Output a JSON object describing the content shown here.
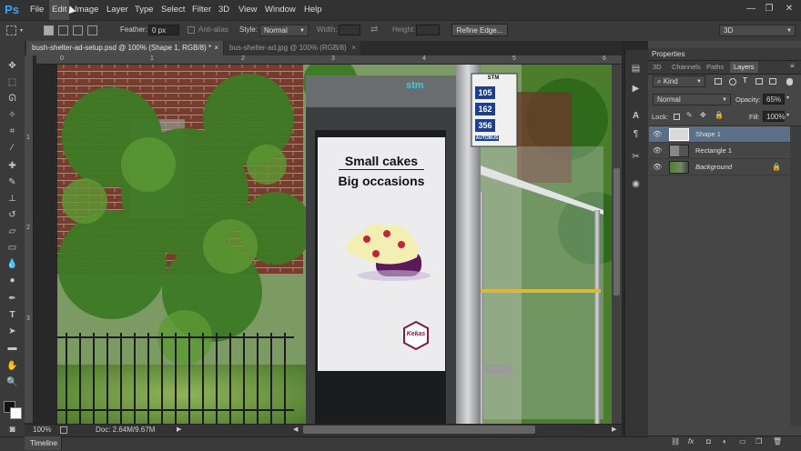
{
  "app": {
    "logo": "Ps"
  },
  "menu": [
    "File",
    "Edit",
    "Image",
    "Layer",
    "Type",
    "Select",
    "Filter",
    "3D",
    "View",
    "Window",
    "Help"
  ],
  "window_controls": {
    "minimize": "—",
    "restore": "❐",
    "close": "✕"
  },
  "options": {
    "feather_label": "Feather:",
    "feather_value": "0 px",
    "antialias_label": "Anti-alias",
    "style_label": "Style:",
    "style_value": "Normal",
    "width_label": "Width:",
    "height_label": "Height:",
    "refine_edge": "Refine Edge...",
    "workspace": "3D"
  },
  "tabs": [
    {
      "label": "bush-shelter-ad-setup.psd @ 100% (Shape 1, RGB/8) *",
      "close": "×"
    },
    {
      "label": "bus-shelter-ad.jpg @ 100% (RGB/8)",
      "close": "×"
    }
  ],
  "ruler_top": [
    "0",
    "1",
    "2",
    "3",
    "4",
    "5",
    "6"
  ],
  "ruler_left": [
    "1",
    "2",
    "3"
  ],
  "status": {
    "zoom": "100%",
    "doc": "Doc: 2.64M/9.67M"
  },
  "timeline_label": "Timeline",
  "canvas": {
    "stm_logo": "stm",
    "sign_numbers": [
      "105",
      "162",
      "356"
    ],
    "sign_top": "STM",
    "sign_bottom": "AUTOBUS",
    "ad_line1": "Small cakes",
    "ad_line2": "Big occasions",
    "brand": "Kekas"
  },
  "panels": {
    "properties": "Properties",
    "tabs": [
      "3D",
      "Channels",
      "Paths",
      "Layers"
    ],
    "kind": "Kind",
    "blend_mode": "Normal",
    "opacity_label": "Opacity:",
    "opacity_value": "65%",
    "lock_label": "Lock:",
    "fill_label": "Fill:",
    "fill_value": "100%"
  },
  "layers": [
    {
      "name": "Shape 1",
      "selected": true
    },
    {
      "name": "Rectangle 1",
      "selected": false
    },
    {
      "name": "Background",
      "selected": false,
      "locked": true
    }
  ]
}
